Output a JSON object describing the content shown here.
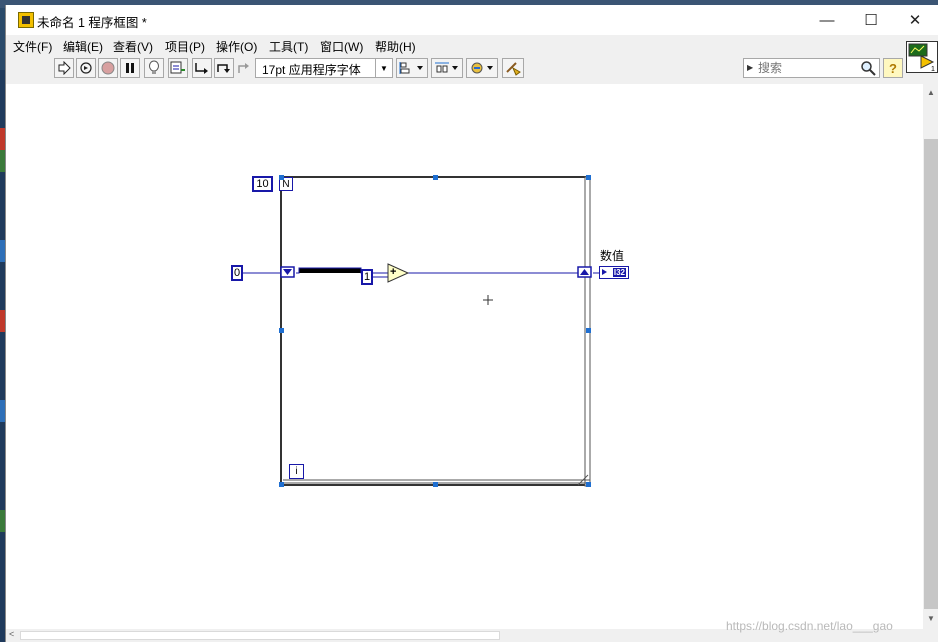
{
  "window": {
    "title": "未命名 1 程序框图 *",
    "controls": {
      "minimize": "—",
      "maximize": "☐",
      "close": "✕"
    }
  },
  "menu": [
    "文件(F)",
    "编辑(E)",
    "查看(V)",
    "项目(P)",
    "操作(O)",
    "工具(T)",
    "窗口(W)",
    "帮助(H)"
  ],
  "toolbar": {
    "font": "17pt 应用程序字体",
    "search_placeholder": "搜索",
    "help": "?"
  },
  "diagram": {
    "loop_count_constant": "10",
    "loop_count_terminal": "N",
    "iteration_terminal": "i",
    "init_constant": "0",
    "increment_constant": "1",
    "add_symbol": "+",
    "indicator_label": "数值",
    "indicator_type": "I32"
  },
  "watermark": "https://blog.csdn.net/lao___gao",
  "colors": {
    "wire": "#1818a8",
    "loop_border": "#444444",
    "handle": "#1f6fd1",
    "add_node": "#ffffc8"
  }
}
